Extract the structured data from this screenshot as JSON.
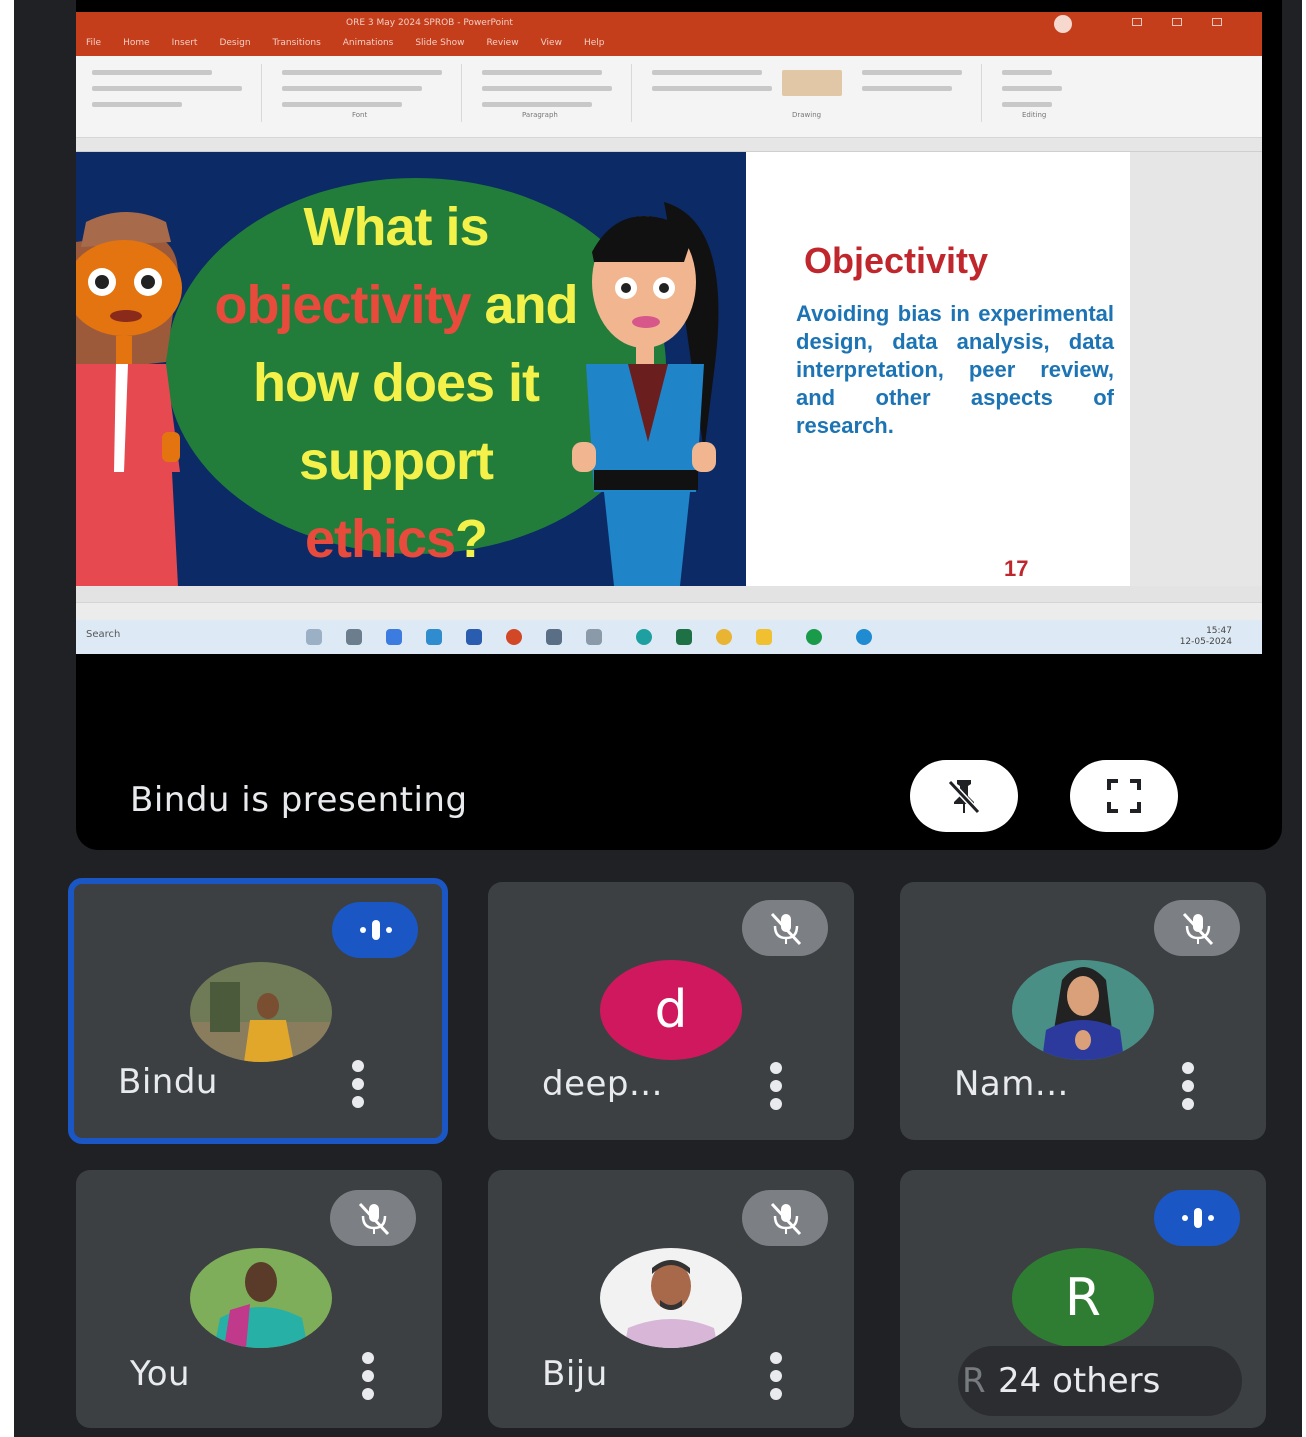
{
  "shared_screen": {
    "powerpoint": {
      "doc_title": "ORE 3 May 2024 SPROB - PowerPoint",
      "tabs": [
        "File",
        "Home",
        "Insert",
        "Design",
        "Transitions",
        "Animations",
        "Slide Show",
        "Review",
        "View",
        "Help"
      ],
      "ribbon_groups": [
        "Font",
        "Paragraph",
        "Drawing",
        "Editing"
      ],
      "slide": {
        "question_line1": "What is",
        "question_line2_red": "objectivity",
        "question_line2_yellow": " and",
        "question_line3": "how does it",
        "question_line4": "support",
        "question_line5_red": "ethics",
        "question_line5_yellow": "?",
        "right_title": "Objectivity",
        "right_body": "Avoiding bias in experimental design, data analysis, data interpretation, peer review, and other aspects of research.",
        "slide_number": "17"
      }
    },
    "taskbar": {
      "search": "Search",
      "time": "15:47",
      "date": "12-05-2024"
    }
  },
  "presenting_text": "Bindu is presenting",
  "controls": {
    "unpin_icon": "unpin-icon",
    "fullscreen_icon": "fullscreen-icon"
  },
  "participants": [
    {
      "name": "Bindu",
      "status": "speaking",
      "avatar": "photo"
    },
    {
      "name": "deep...",
      "status": "muted",
      "avatar": "letter",
      "letter": "d",
      "color": "#d0185e"
    },
    {
      "name": "Nam...",
      "status": "muted",
      "avatar": "photo"
    },
    {
      "name": "You",
      "status": "muted",
      "avatar": "photo"
    },
    {
      "name": "Biju",
      "status": "muted",
      "avatar": "photo"
    },
    {
      "name": "R",
      "status": "speaking",
      "avatar": "letter",
      "letter": "R",
      "color": "#2f7d32"
    }
  ],
  "others_label": "24 others",
  "others_hidden_prefix": "R"
}
